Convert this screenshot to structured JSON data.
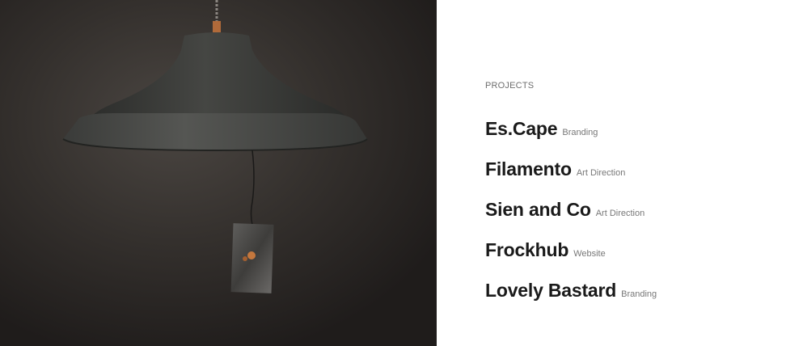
{
  "hero": {
    "image_icon": "pendant-lamp-photo"
  },
  "projects": {
    "heading": "PROJECTS",
    "items": [
      {
        "name": "Es.Cape",
        "category": "Branding"
      },
      {
        "name": "Filamento",
        "category": "Art Direction"
      },
      {
        "name": "Sien and Co",
        "category": "Art Direction"
      },
      {
        "name": "Frockhub",
        "category": "Website"
      },
      {
        "name": "Lovely Bastard",
        "category": "Branding"
      }
    ]
  },
  "colors": {
    "photo_background": "#2e2a28",
    "lamp_shade": "#3b3c3a",
    "cord_accent": "#b06a3a",
    "heading_text": "#6f6f6f",
    "project_name_text": "#1a1a1a",
    "category_text": "#777777"
  }
}
